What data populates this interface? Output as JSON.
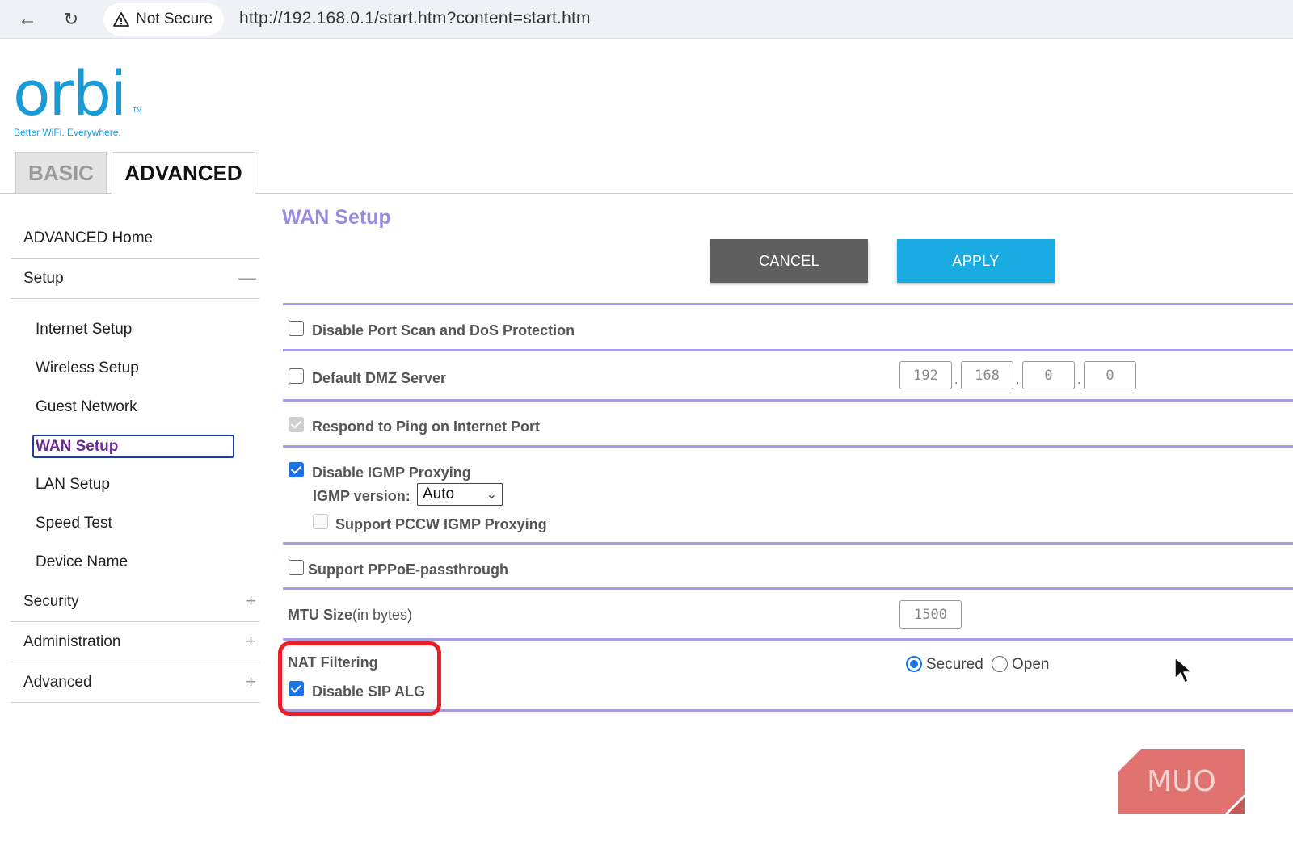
{
  "browser": {
    "security_label": "Not Secure",
    "url": "http://192.168.0.1/start.htm?content=start.htm",
    "icons": [
      "back-arrow-icon",
      "reload-icon",
      "warning-icon"
    ]
  },
  "logo": {
    "word": "orbi",
    "tm": "TM",
    "tagline": "Better WiFi. Everywhere."
  },
  "tabs": [
    {
      "label": "BASIC",
      "active": false
    },
    {
      "label": "ADVANCED",
      "active": true
    }
  ],
  "sidebar": {
    "home": "ADVANCED Home",
    "setup": {
      "label": "Setup",
      "toggle": "—"
    },
    "setup_items": [
      "Internet Setup",
      "Wireless Setup",
      "Guest Network",
      "WAN Setup",
      "LAN Setup",
      "Speed Test",
      "Device Name"
    ],
    "active_item": "WAN Setup",
    "sections": [
      {
        "label": "Security",
        "toggle": "+"
      },
      {
        "label": "Administration",
        "toggle": "+"
      },
      {
        "label": "Advanced",
        "toggle": "+"
      }
    ]
  },
  "main": {
    "title": "WAN Setup",
    "cancel_label": "CANCEL",
    "apply_label": "APPLY",
    "port_scan": {
      "label": "Disable Port Scan and DoS Protection",
      "checked": false
    },
    "dmz": {
      "label": "Default DMZ Server",
      "checked": false,
      "ip": [
        "192",
        "168",
        "0",
        "0"
      ]
    },
    "ping": {
      "label": "Respond to Ping on Internet Port",
      "checked": true,
      "disabled": true
    },
    "igmp": {
      "label": "Disable IGMP Proxying",
      "checked": true,
      "version_label": "IGMP version:",
      "version_value": "Auto"
    },
    "pccw": {
      "label": "Support PCCW IGMP Proxying",
      "checked": false,
      "disabled": true
    },
    "pppoe": {
      "label": "Support PPPoE-passthrough",
      "checked": false
    },
    "mtu": {
      "label": "MTU Size",
      "unit": "(in bytes)",
      "value": "1500"
    },
    "nat": {
      "label": "NAT Filtering",
      "options": [
        "Secured",
        "Open"
      ],
      "selected": "Secured"
    },
    "sip": {
      "label": "Disable SIP ALG",
      "checked": true
    }
  },
  "colors": {
    "brand": "#1a9bd7",
    "title": "#9b8ae0",
    "rule": "#a99ce3",
    "apply": "#19abe2",
    "cancel": "#5f5f5f",
    "highlight": "#ee1d25",
    "check": "#1a73e8"
  },
  "watermark": "MUO"
}
